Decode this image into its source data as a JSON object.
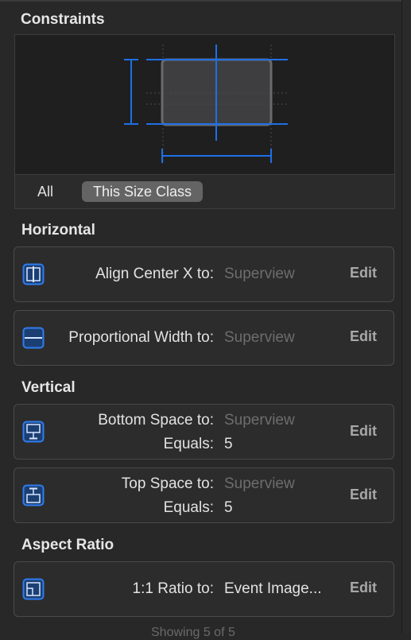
{
  "header": {
    "title": "Constraints"
  },
  "tabs": {
    "all": "All",
    "selected": "This Size Class"
  },
  "sections": {
    "horizontal": "Horizontal",
    "vertical": "Vertical",
    "aspect": "Aspect Ratio"
  },
  "constraints": {
    "align_center_x": {
      "label": "Align Center X to:",
      "value": "Superview",
      "edit": "Edit"
    },
    "proportional_width": {
      "label": "Proportional Width to:",
      "value": "Superview",
      "edit": "Edit"
    },
    "bottom_space": {
      "label": "Bottom Space to:",
      "value": "Superview",
      "equals_label": "Equals:",
      "equals_value": "5",
      "edit": "Edit"
    },
    "top_space": {
      "label": "Top Space to:",
      "value": "Superview",
      "equals_label": "Equals:",
      "equals_value": "5",
      "edit": "Edit"
    },
    "ratio": {
      "label": "1:1 Ratio to:",
      "value": "Event Image...",
      "edit": "Edit"
    }
  },
  "footer": {
    "text": "Showing 5 of 5"
  },
  "colors": {
    "accent": "#1f6fe6",
    "background": "#282828"
  }
}
